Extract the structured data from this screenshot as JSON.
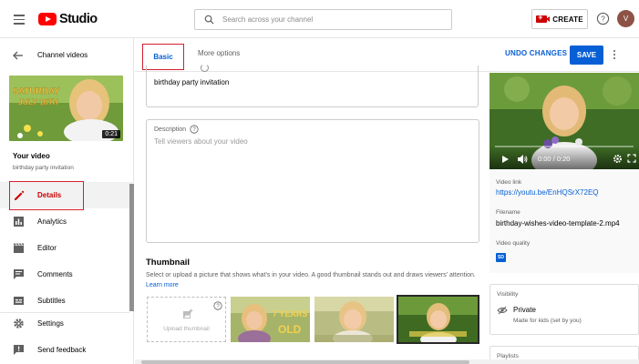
{
  "app": {
    "logo_text": "Studio"
  },
  "search": {
    "placeholder": "Search across your channel"
  },
  "header": {
    "create_label": "CREATE",
    "avatar_letter": "V"
  },
  "sidebar": {
    "back_label": "Channel videos",
    "video_duration": "0:21",
    "your_video_label": "Your video",
    "video_subtitle": "birthday party invitation",
    "items": [
      {
        "label": "Details",
        "icon": "pencil-icon",
        "active": true
      },
      {
        "label": "Analytics",
        "icon": "analytics-icon"
      },
      {
        "label": "Editor",
        "icon": "editor-icon"
      },
      {
        "label": "Comments",
        "icon": "comments-icon"
      },
      {
        "label": "Subtitles",
        "icon": "subtitles-icon"
      },
      {
        "label": "Settings",
        "icon": "gear-icon"
      },
      {
        "label": "Send feedback",
        "icon": "feedback-icon"
      }
    ]
  },
  "tabs": {
    "basic": "Basic",
    "more": "More options"
  },
  "actions": {
    "undo": "UNDO CHANGES",
    "save": "SAVE"
  },
  "form": {
    "title_value": "birthday party invitation",
    "description_label": "Description",
    "description_placeholder": "Tell viewers about your video",
    "thumbnail_heading": "Thumbnail",
    "thumbnail_desc": "Select or upload a picture that shows what's in your video. A good thumbnail stands out and draws viewers' attention.",
    "learn_more": "Learn more",
    "upload_label": "Upload thumbnail",
    "thumb_text_1": "7 YEARS",
    "thumb_text_2": "OLD"
  },
  "preview": {
    "sidebar_overlay_1": "SATURDAY",
    "sidebar_overlay_2": "JULY 18TH",
    "time": "0:00 / 0:20",
    "link_label": "Video link",
    "link_value": "https://youtu.be/EnHQSrX72EQ",
    "filename_label": "Filename",
    "filename_value": "birthday-wishes-video-template-2.mp4",
    "quality_label": "Video quality",
    "quality_badge": "SD"
  },
  "visibility": {
    "label": "Visibility",
    "value": "Private",
    "sub": "Made for kids (set by you)"
  },
  "playlists": {
    "label": "Playlists"
  },
  "colors": {
    "accent": "#065fd4",
    "brand_red": "#ff0000",
    "highlight_box": "#d52030"
  }
}
